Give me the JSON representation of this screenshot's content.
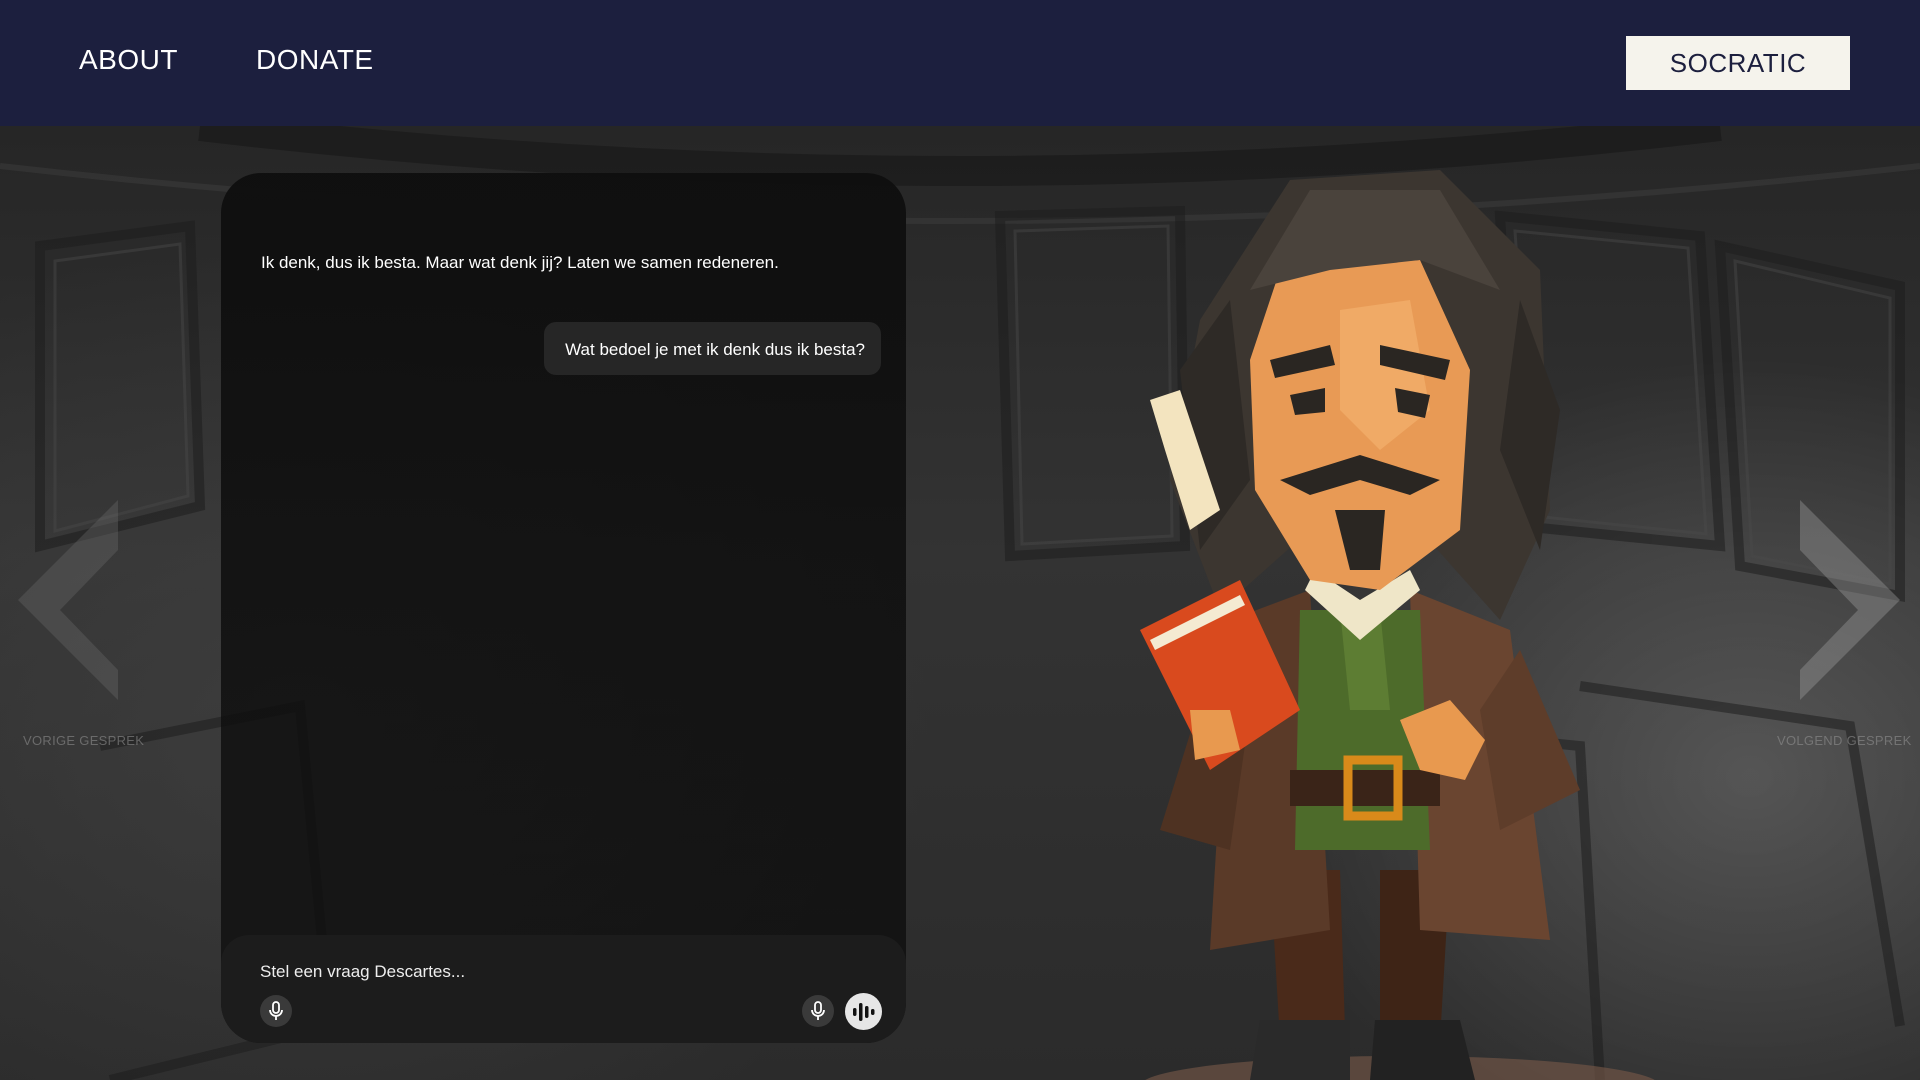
{
  "header": {
    "nav": [
      {
        "label": "ABOUT"
      },
      {
        "label": "DONATE"
      }
    ],
    "brand_button": "SOCRATIC"
  },
  "chat": {
    "messages": [
      {
        "role": "assistant",
        "text": "Ik denk, dus ik besta. Maar wat denk jij? Laten we samen redeneren."
      },
      {
        "role": "user",
        "text": "Wat bedoel je met ik denk dus ik besta?"
      }
    ],
    "composer": {
      "placeholder": "Stel een vraag Descartes..."
    },
    "icons": {
      "mic_left": "microphone-icon",
      "mic_right": "microphone-icon",
      "voice": "voice-wave-icon"
    }
  },
  "navigation": {
    "previous_label": "VORIGE GESPREK",
    "next_label": "VOLGEND GESPREK"
  },
  "colors": {
    "header_bg": "#1c1f3e",
    "brand_button_bg": "#f5f3ec",
    "panel_bg": "#0e0e0e",
    "bubble_bg": "#262626"
  }
}
